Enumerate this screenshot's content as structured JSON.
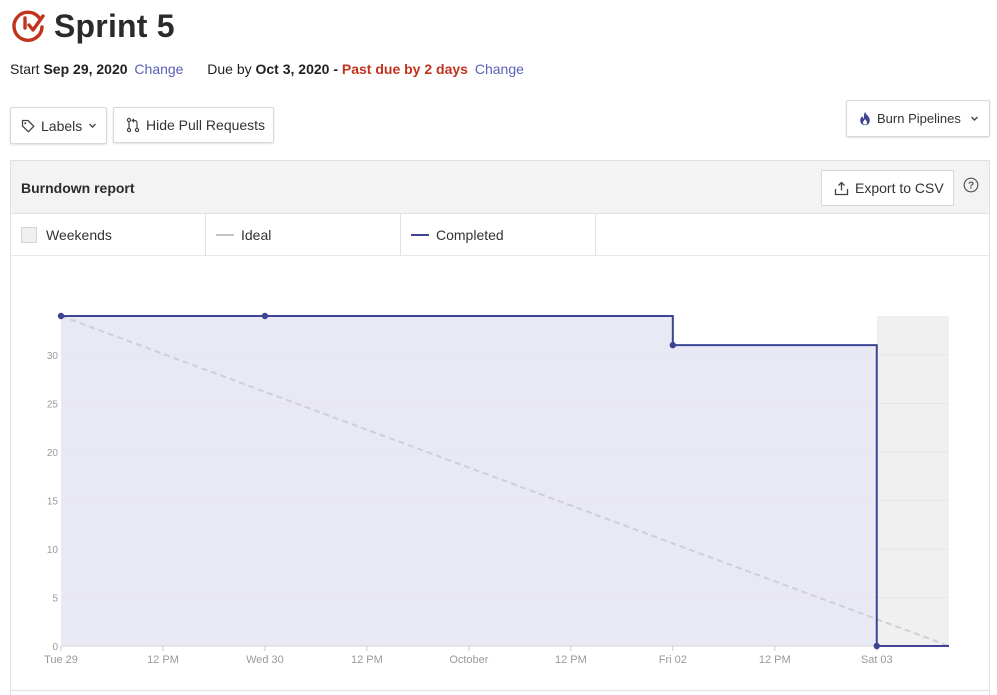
{
  "header": {
    "title": "Sprint 5",
    "start_label": "Start",
    "start_date": "Sep 29, 2020",
    "start_change": "Change",
    "due_label": "Due by",
    "due_date": "Oct 3, 2020",
    "due_sep": " - ",
    "past_due": "Past due by 2 days",
    "due_change": "Change"
  },
  "toolbar": {
    "labels_button": "Labels",
    "hide_pr_button": "Hide Pull Requests",
    "burn_button": "Burn Pipelines"
  },
  "report": {
    "title": "Burndown report",
    "export_button": "Export to CSV"
  },
  "legend": {
    "weekends": "Weekends",
    "ideal": "Ideal",
    "completed": "Completed"
  },
  "colors": {
    "brand": "#c0341d",
    "completed": "#3d4592",
    "completed_fill": "#e9e9f6",
    "ideal": "#cfcfd6",
    "weekend": "#f0f0f0",
    "link": "#5a60b8"
  },
  "chart_data": {
    "type": "line",
    "title": "",
    "xlabel": "",
    "ylabel": "",
    "ylim": [
      0,
      34
    ],
    "yticks": [
      0,
      5,
      10,
      15,
      20,
      25,
      30
    ],
    "xlim_hours": [
      0,
      104.5
    ],
    "xticks": [
      {
        "h": 0,
        "label": "Tue 29"
      },
      {
        "h": 12,
        "label": "12 PM"
      },
      {
        "h": 24,
        "label": "Wed 30"
      },
      {
        "h": 36,
        "label": "12 PM"
      },
      {
        "h": 48,
        "label": "October"
      },
      {
        "h": 60,
        "label": "12 PM"
      },
      {
        "h": 72,
        "label": "Fri 02"
      },
      {
        "h": 84,
        "label": "12 PM"
      },
      {
        "h": 96,
        "label": "Sat 03"
      }
    ],
    "weekend_start_h": 96,
    "series": [
      {
        "name": "Completed",
        "step": true,
        "points": [
          {
            "h": 0,
            "y": 34,
            "marker": true
          },
          {
            "h": 24,
            "y": 34,
            "marker": true
          },
          {
            "h": 72,
            "y": 31,
            "marker": true
          },
          {
            "h": 96,
            "y": 0,
            "marker": true
          },
          {
            "h": 104.5,
            "y": 0,
            "marker": false
          }
        ]
      },
      {
        "name": "Ideal",
        "dashed": true,
        "points": [
          {
            "h": 0,
            "y": 34
          },
          {
            "h": 104.5,
            "y": 0
          }
        ]
      }
    ]
  }
}
